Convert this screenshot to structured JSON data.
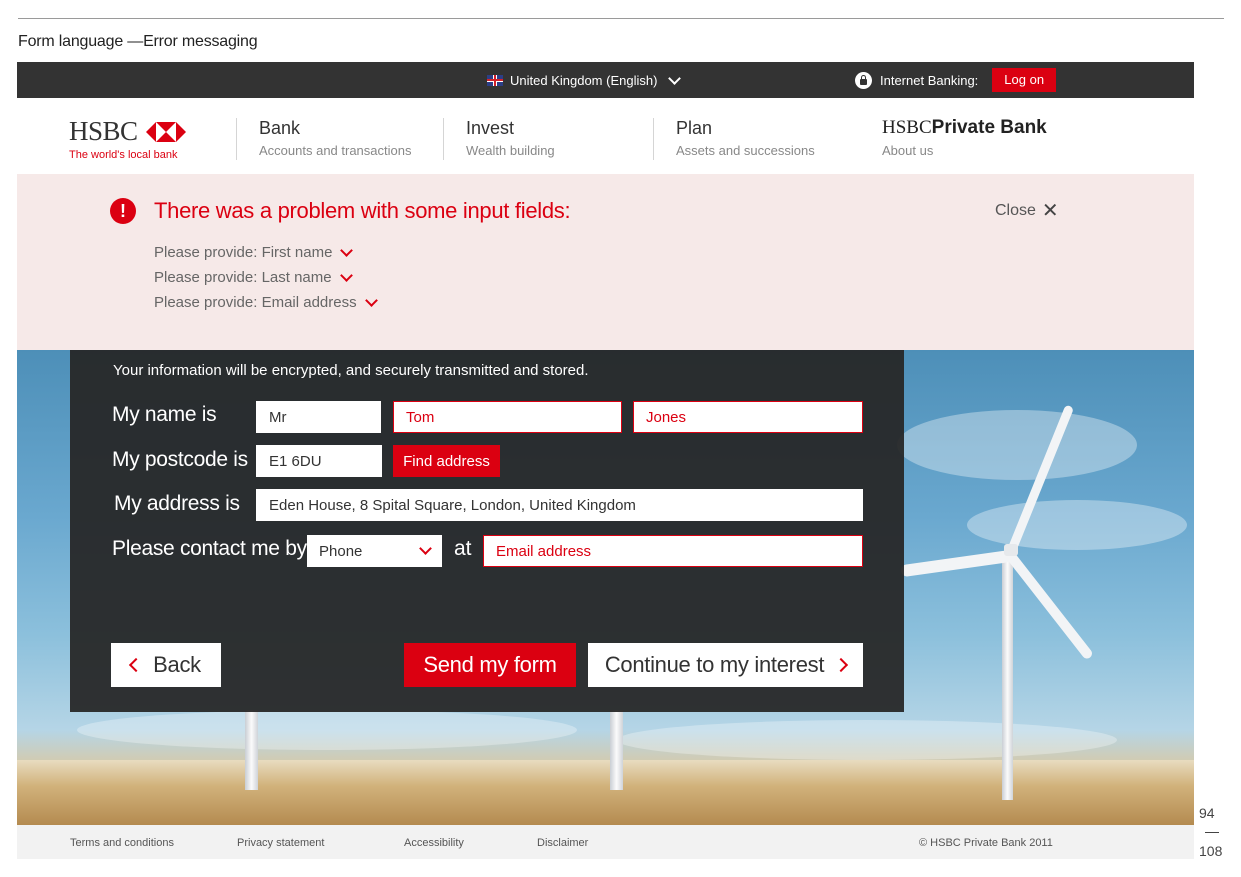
{
  "doc": {
    "title": "Form language —Error messaging",
    "page_current": "94",
    "page_total": "108"
  },
  "topbar": {
    "region": "United Kingdom (English)",
    "internet_banking": "Internet Banking:",
    "logon": "Log on"
  },
  "brand": {
    "name": "HSBC",
    "tagline": "The world's local bank"
  },
  "nav": {
    "items": [
      {
        "title": "Bank",
        "sub": "Accounts and transactions"
      },
      {
        "title": "Invest",
        "sub": "Wealth building"
      },
      {
        "title": "Plan",
        "sub": "Assets and successions"
      }
    ],
    "private_bank": {
      "prefix": "HSBC",
      "suffix": "Private Bank",
      "sub": "About us"
    }
  },
  "error": {
    "icon": "!",
    "title": "There was a problem with some input fields:",
    "items": [
      "Please provide: First name",
      "Please provide: Last name",
      "Please provide: Email address"
    ],
    "close": "Close"
  },
  "form": {
    "encryption_note": "Your information will be encrypted, and securely transmitted and stored.",
    "name_label": "My name is",
    "title_value": "Mr",
    "first_name_placeholder": "Tom",
    "last_name_placeholder": "Jones",
    "postcode_label": "My postcode is",
    "postcode_value": "E1 6DU",
    "find_address": "Find address",
    "address_label": "My address is",
    "address_value": "Eden House,  8 Spital Square, London, United Kingdom",
    "contact_label": "Please contact me by",
    "contact_method": "Phone",
    "at_label": "at",
    "email_placeholder": "Email address",
    "back": "Back",
    "send": "Send my form",
    "continue": "Continue to my interest"
  },
  "footer": {
    "links": [
      "Terms and conditions",
      "Privacy statement",
      "Accessibility",
      "Disclaimer"
    ],
    "copyright": "© HSBC Private Bank 2011"
  },
  "colors": {
    "brand_red": "#db0011",
    "topbar": "#333333",
    "error_bg": "#f6e9e8"
  }
}
